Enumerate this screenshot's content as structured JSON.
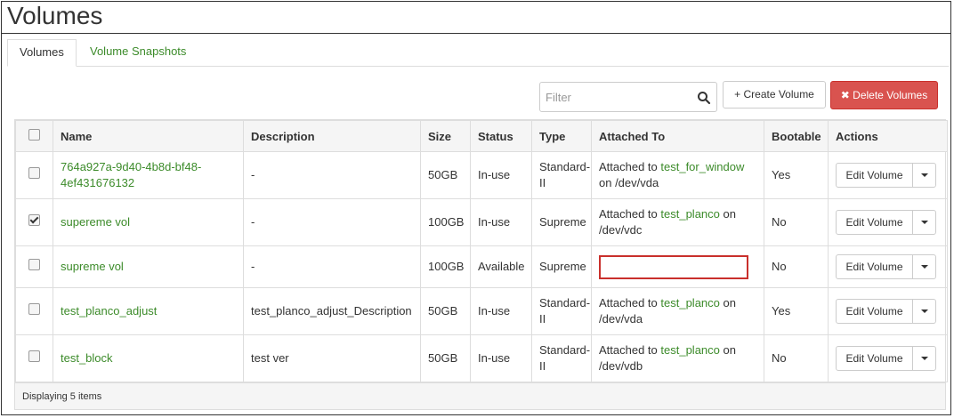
{
  "page": {
    "title": "Volumes"
  },
  "tabs": [
    {
      "label": "Volumes",
      "active": true
    },
    {
      "label": "Volume Snapshots",
      "active": false
    }
  ],
  "toolbar": {
    "filter_placeholder": "Filter",
    "search_icon": "search-icon",
    "create_label": "+ Create Volume",
    "delete_label": "✖ Delete Volumes"
  },
  "table": {
    "headers": [
      "Name",
      "Description",
      "Size",
      "Status",
      "Type",
      "Attached To",
      "Bootable",
      "Actions"
    ],
    "rows": [
      {
        "checked": false,
        "name": "764a927a-9d40-4b8d-bf48-4ef431676132",
        "description": "-",
        "size": "50GB",
        "status": "In-use",
        "type": "Standard-II",
        "attached_prefix": "Attached to ",
        "attached_link": "test_for_window",
        "attached_suffix": " on /dev/vda",
        "bootable": "Yes",
        "action": "Edit Volume"
      },
      {
        "checked": true,
        "name": "supereme vol",
        "description": "-",
        "size": "100GB",
        "status": "In-use",
        "type": "Supreme",
        "attached_prefix": "Attached to ",
        "attached_link": "test_planco",
        "attached_suffix": " on /dev/vdc",
        "bootable": "No",
        "action": "Edit Volume"
      },
      {
        "checked": false,
        "name": "supreme vol",
        "description": "-",
        "size": "100GB",
        "status": "Available",
        "type": "Supreme",
        "attached_prefix": "",
        "attached_link": "",
        "attached_suffix": "",
        "bootable": "No",
        "action": "Edit Volume"
      },
      {
        "checked": false,
        "name": "test_planco_adjust",
        "description": "test_planco_adjust_Description",
        "size": "50GB",
        "status": "In-use",
        "type": "Standard-II",
        "attached_prefix": "Attached to ",
        "attached_link": "test_planco",
        "attached_suffix": " on /dev/vda",
        "bootable": "Yes",
        "action": "Edit Volume"
      },
      {
        "checked": false,
        "name": "test_block",
        "description": "test ver",
        "size": "50GB",
        "status": "In-use",
        "type": "Standard-II",
        "attached_prefix": "Attached to ",
        "attached_link": "test_planco",
        "attached_suffix": " on /dev/vdb",
        "bootable": "No",
        "action": "Edit Volume"
      }
    ],
    "footer": "Displaying 5 items"
  },
  "colors": {
    "link": "#3c8b2a",
    "danger": "#d9534f",
    "highlight_border": "#c9302c"
  }
}
